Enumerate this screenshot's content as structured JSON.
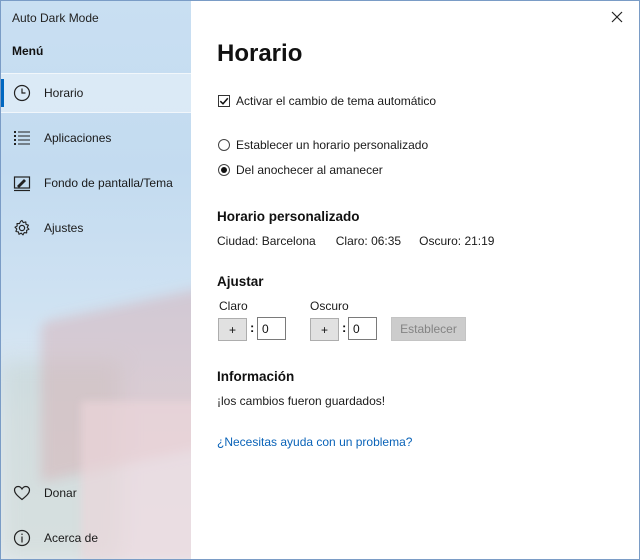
{
  "app": {
    "title": "Auto Dark Mode"
  },
  "sidebar": {
    "menu_title": "Menú",
    "items": [
      {
        "label": "Horario",
        "icon": "clock-icon",
        "selected": true
      },
      {
        "label": "Aplicaciones",
        "icon": "list-icon",
        "selected": false
      },
      {
        "label": "Fondo de pantalla/Tema",
        "icon": "paint-icon",
        "selected": false
      },
      {
        "label": "Ajustes",
        "icon": "gear-icon",
        "selected": false
      }
    ],
    "bottom_items": [
      {
        "label": "Donar",
        "icon": "heart-icon"
      },
      {
        "label": "Acerca de",
        "icon": "info-icon"
      }
    ]
  },
  "main": {
    "title": "Horario",
    "auto_theme": {
      "label": "Activar el cambio de tema automático",
      "checked": true
    },
    "options": [
      {
        "label": "Establecer un horario personalizado",
        "selected": false
      },
      {
        "label": "Del anochecer al amanecer",
        "selected": true
      }
    ],
    "custom_schedule": {
      "title": "Horario personalizado",
      "city": "Ciudad: Barcelona",
      "light": "Claro: 06:35",
      "dark": "Oscuro: 21:19"
    },
    "adjust": {
      "title": "Ajustar",
      "light_label": "Claro",
      "dark_label": "Oscuro",
      "plus_label": "+",
      "separator": ":",
      "light_value": "0",
      "dark_value": "0",
      "set_button": "Establecer"
    },
    "info": {
      "title": "Información",
      "message": "¡los cambios fueron guardados!"
    },
    "help_link": "¿Necesitas ayuda con un problema?"
  },
  "colors": {
    "accent": "#0067c0",
    "link": "#0a63b8",
    "disabled_button": "#cccccc"
  }
}
